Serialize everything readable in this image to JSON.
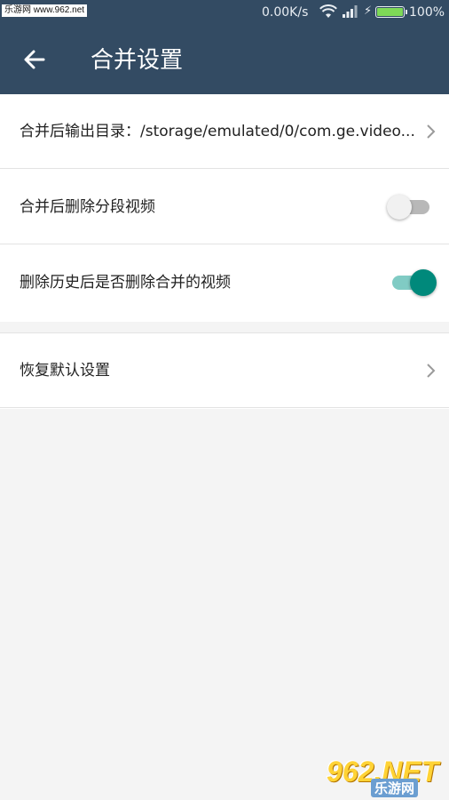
{
  "status_bar": {
    "watermark": "乐游网 www.962.net",
    "network_speed": "0.00K/s",
    "battery_percent": "100%",
    "battery_level": 1.0,
    "battery_color": "#7ed957"
  },
  "header": {
    "title": "合并设置",
    "background": "#334b63",
    "back_icon": "arrow-left-icon"
  },
  "settings": {
    "output_dir_label": "合并后输出目录：/storage/emulated/0/com.ge.video...",
    "delete_segments_label": "合并后删除分段视频",
    "delete_segments_on": false,
    "delete_merged_label": "删除历史后是否删除合并的视频",
    "delete_merged_on": true,
    "restore_defaults_label": "恢复默认设置",
    "accent_color": "#00897b"
  },
  "watermark_bottom": {
    "brand": "962.NET",
    "subtitle": "乐游网"
  }
}
